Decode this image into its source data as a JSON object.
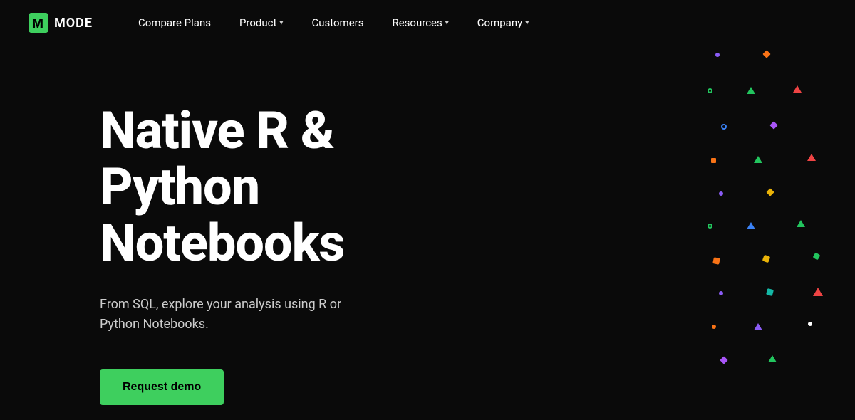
{
  "logo": {
    "text": "MODE",
    "aria": "Mode Analytics"
  },
  "nav": {
    "links": [
      {
        "label": "Compare Plans",
        "hasDropdown": false
      },
      {
        "label": "Product",
        "hasDropdown": true
      },
      {
        "label": "Customers",
        "hasDropdown": false
      },
      {
        "label": "Resources",
        "hasDropdown": true
      },
      {
        "label": "Company",
        "hasDropdown": true
      }
    ]
  },
  "hero": {
    "title_line1": "Native R & Python",
    "title_line2": "Notebooks",
    "subtitle": "From SQL, explore your analysis using R or Python Notebooks.",
    "cta_label": "Request demo"
  }
}
